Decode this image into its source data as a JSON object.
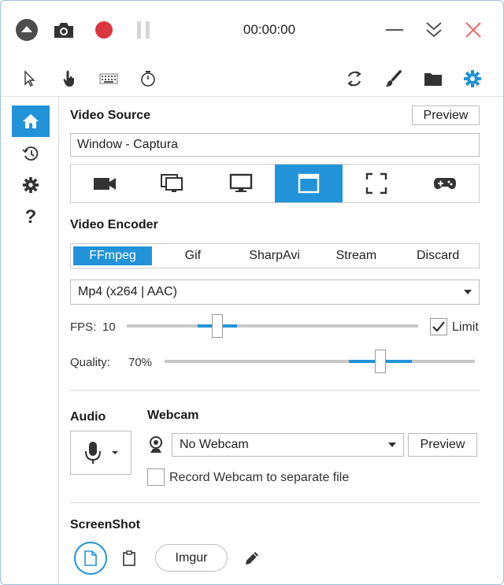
{
  "titlebar": {
    "timer": "00:00:00",
    "icons": [
      "collapse-icon",
      "camera-icon",
      "record-icon",
      "pause-icon",
      "minimize-icon",
      "expand-down-icon",
      "close-icon"
    ]
  },
  "toolbar": {
    "icons": [
      "cursor-icon",
      "click-icon",
      "keystrokes-icon",
      "timer-icon",
      "refresh-icon",
      "brush-icon",
      "folder-icon",
      "settings-icon"
    ]
  },
  "sidebar": {
    "items": [
      "home-icon",
      "history-icon",
      "settings-icon",
      "help-icon"
    ],
    "help_glyph": "?"
  },
  "video_source": {
    "heading": "Video Source",
    "preview_label": "Preview",
    "value": "Window  -  Captura",
    "sources": [
      "camera",
      "overlay-screens",
      "screen",
      "window",
      "region",
      "game"
    ],
    "active_source": "window"
  },
  "video_encoder": {
    "heading": "Video Encoder",
    "tabs": [
      "FFmpeg",
      "Gif",
      "SharpAvi",
      "Stream",
      "Discard"
    ],
    "active_tab": "FFmpeg",
    "codec": "Mp4 (x264 | AAC)",
    "fps_label": "FPS:",
    "fps_value": "10",
    "limit_label": "Limit",
    "limit_checked": true,
    "quality_label": "Quality:",
    "quality_value": "70%",
    "quality_fraction": 0.7
  },
  "audio": {
    "heading": "Audio"
  },
  "webcam": {
    "heading": "Webcam",
    "selected": "No Webcam",
    "preview_label": "Preview",
    "separate_file_label": "Record Webcam to separate file",
    "separate_file_checked": false
  },
  "screenshot": {
    "heading": "ScreenShot",
    "imgur_label": "Imgur"
  },
  "colors": {
    "accent": "#2393d9",
    "record": "#d9363e",
    "close": "#e86a6a"
  }
}
